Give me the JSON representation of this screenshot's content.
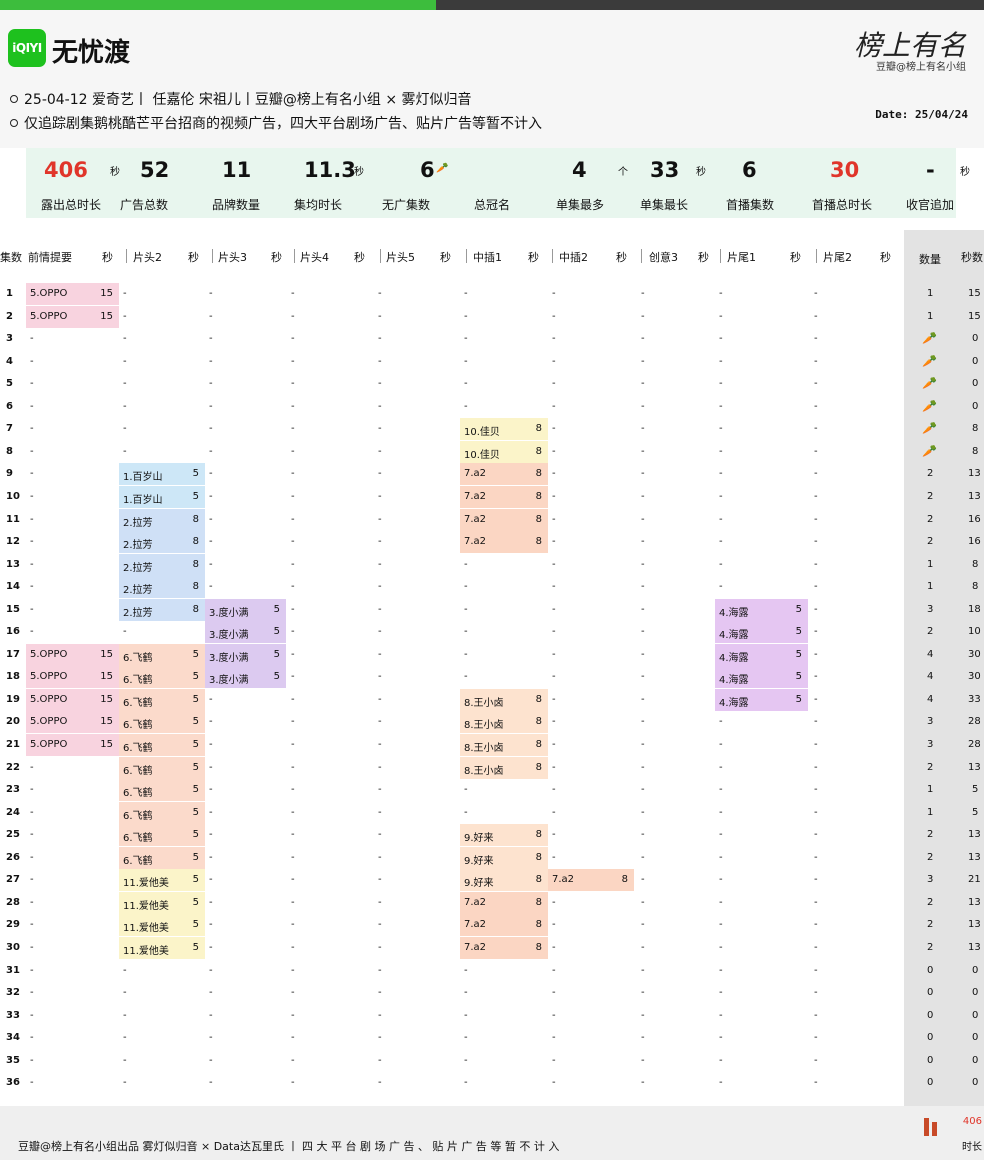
{
  "app": {
    "logo_text": "iQIYI",
    "show_title": "无忧渡",
    "info_line1": "25-04-12 爱奇艺丨 任嘉伦 宋祖儿丨豆瓣@榜上有名小组 × 雾灯似归音",
    "info_line2": "仅追踪剧集鹅桃酷芒平台招商的视频广告，四大平台剧场广告、贴片广告等暂不计入",
    "brand_signature": "榜上有名",
    "brand_sub": "豆瓣@榜上有名小组",
    "date": "Date: 25/04/24"
  },
  "stats": [
    {
      "value": "406",
      "unit": "秒",
      "label": "露出总时长",
      "red": true
    },
    {
      "value": "52",
      "unit": "",
      "label": "广告总数",
      "red": false
    },
    {
      "value": "11",
      "unit": "",
      "label": "品牌数量",
      "red": false
    },
    {
      "value": "11.3",
      "unit": "秒",
      "label": "集均时长",
      "red": false
    },
    {
      "value": "6",
      "unit": "🥕",
      "label": "无广集数",
      "red": false
    },
    {
      "value": "",
      "unit": "",
      "label": "总冠名",
      "red": false
    },
    {
      "value": "4",
      "unit": "个",
      "label": "单集最多",
      "red": false
    },
    {
      "value": "33",
      "unit": "秒",
      "label": "单集最长",
      "red": false
    },
    {
      "value": "6",
      "unit": "",
      "label": "首播集数",
      "red": false
    },
    {
      "value": "30",
      "unit": "",
      "label": "首播总时长",
      "red": true
    },
    {
      "value": "-",
      "unit": "秒",
      "label": "收官追加",
      "red": false
    }
  ],
  "columns": {
    "ep": "集数",
    "c1": "前情提要",
    "c1u": "秒",
    "c2": "片头2",
    "c2u": "秒",
    "c3": "片头3",
    "c3u": "秒",
    "c4": "片头4",
    "c4u": "秒",
    "c5": "片头5",
    "c5u": "秒",
    "c6": "中插1",
    "c6u": "秒",
    "c7": "中插2",
    "c7u": "秒",
    "c8": "创意3",
    "c8u": "秒",
    "c9": "片尾1",
    "c9u": "秒",
    "c10": "片尾2",
    "c10u": "秒",
    "count": "数量",
    "seconds": "秒数"
  },
  "rows": [
    {
      "ep": "1",
      "cells": [
        [
          "5.OPPO",
          "15"
        ],
        "-",
        "-",
        "-",
        "-",
        "-",
        "-",
        "-",
        "-",
        "-"
      ],
      "count": "1",
      "sec": "15"
    },
    {
      "ep": "2",
      "cells": [
        [
          "5.OPPO",
          "15"
        ],
        "-",
        "-",
        "-",
        "-",
        "-",
        "-",
        "-",
        "-",
        "-"
      ],
      "count": "1",
      "sec": "15"
    },
    {
      "ep": "3",
      "cells": [
        "-",
        "-",
        "-",
        "-",
        "-",
        "-",
        "-",
        "-",
        "-",
        "-"
      ],
      "count": "🥕",
      "sec": "0"
    },
    {
      "ep": "4",
      "cells": [
        "-",
        "-",
        "-",
        "-",
        "-",
        "-",
        "-",
        "-",
        "-",
        "-"
      ],
      "count": "🥕",
      "sec": "0"
    },
    {
      "ep": "5",
      "cells": [
        "-",
        "-",
        "-",
        "-",
        "-",
        "-",
        "-",
        "-",
        "-",
        "-"
      ],
      "count": "🥕",
      "sec": "0"
    },
    {
      "ep": "6",
      "cells": [
        "-",
        "-",
        "-",
        "-",
        "-",
        "-",
        "-",
        "-",
        "-",
        "-"
      ],
      "count": "🥕",
      "sec": "0"
    },
    {
      "ep": "7",
      "cells": [
        "-",
        "-",
        "-",
        "-",
        "-",
        [
          "10.佳贝",
          "8"
        ],
        "-",
        "-",
        "-",
        "-"
      ],
      "count": "🥕",
      "sec": "8"
    },
    {
      "ep": "8",
      "cells": [
        "-",
        "-",
        "-",
        "-",
        "-",
        [
          "10.佳贝",
          "8"
        ],
        "-",
        "-",
        "-",
        "-"
      ],
      "count": "🥕",
      "sec": "8"
    },
    {
      "ep": "9",
      "cells": [
        "-",
        [
          "1.百岁山",
          "5"
        ],
        "-",
        "-",
        "-",
        [
          "7.a2",
          "8"
        ],
        "-",
        "-",
        "-",
        "-"
      ],
      "count": "2",
      "sec": "13"
    },
    {
      "ep": "10",
      "cells": [
        "-",
        [
          "1.百岁山",
          "5"
        ],
        "-",
        "-",
        "-",
        [
          "7.a2",
          "8"
        ],
        "-",
        "-",
        "-",
        "-"
      ],
      "count": "2",
      "sec": "13"
    },
    {
      "ep": "11",
      "cells": [
        "-",
        [
          "2.拉芳",
          "8"
        ],
        "-",
        "-",
        "-",
        [
          "7.a2",
          "8"
        ],
        "-",
        "-",
        "-",
        "-"
      ],
      "count": "2",
      "sec": "16"
    },
    {
      "ep": "12",
      "cells": [
        "-",
        [
          "2.拉芳",
          "8"
        ],
        "-",
        "-",
        "-",
        [
          "7.a2",
          "8"
        ],
        "-",
        "-",
        "-",
        "-"
      ],
      "count": "2",
      "sec": "16"
    },
    {
      "ep": "13",
      "cells": [
        "-",
        [
          "2.拉芳",
          "8"
        ],
        "-",
        "-",
        "-",
        "-",
        "-",
        "-",
        "-",
        "-"
      ],
      "count": "1",
      "sec": "8"
    },
    {
      "ep": "14",
      "cells": [
        "-",
        [
          "2.拉芳",
          "8"
        ],
        "-",
        "-",
        "-",
        "-",
        "-",
        "-",
        "-",
        "-"
      ],
      "count": "1",
      "sec": "8"
    },
    {
      "ep": "15",
      "cells": [
        "-",
        [
          "2.拉芳",
          "8"
        ],
        [
          "3.度小满",
          "5"
        ],
        "-",
        "-",
        "-",
        "-",
        "-",
        [
          "4.海露",
          "5"
        ],
        "-"
      ],
      "count": "3",
      "sec": "18"
    },
    {
      "ep": "16",
      "cells": [
        "-",
        "-",
        [
          "3.度小满",
          "5"
        ],
        "-",
        "-",
        "-",
        "-",
        "-",
        [
          "4.海露",
          "5"
        ],
        "-"
      ],
      "count": "2",
      "sec": "10"
    },
    {
      "ep": "17",
      "cells": [
        [
          "5.OPPO",
          "15"
        ],
        [
          "6.飞鹤",
          "5"
        ],
        [
          "3.度小满",
          "5"
        ],
        "-",
        "-",
        "-",
        "-",
        "-",
        [
          "4.海露",
          "5"
        ],
        "-"
      ],
      "count": "4",
      "sec": "30"
    },
    {
      "ep": "18",
      "cells": [
        [
          "5.OPPO",
          "15"
        ],
        [
          "6.飞鹤",
          "5"
        ],
        [
          "3.度小满",
          "5"
        ],
        "-",
        "-",
        "-",
        "-",
        "-",
        [
          "4.海露",
          "5"
        ],
        "-"
      ],
      "count": "4",
      "sec": "30"
    },
    {
      "ep": "19",
      "cells": [
        [
          "5.OPPO",
          "15"
        ],
        [
          "6.飞鹤",
          "5"
        ],
        "-",
        "-",
        "-",
        [
          "8.王小卤",
          "8"
        ],
        "-",
        "-",
        [
          "4.海露",
          "5"
        ],
        "-"
      ],
      "count": "4",
      "sec": "33"
    },
    {
      "ep": "20",
      "cells": [
        [
          "5.OPPO",
          "15"
        ],
        [
          "6.飞鹤",
          "5"
        ],
        "-",
        "-",
        "-",
        [
          "8.王小卤",
          "8"
        ],
        "-",
        "-",
        "-",
        "-"
      ],
      "count": "3",
      "sec": "28"
    },
    {
      "ep": "21",
      "cells": [
        [
          "5.OPPO",
          "15"
        ],
        [
          "6.飞鹤",
          "5"
        ],
        "-",
        "-",
        "-",
        [
          "8.王小卤",
          "8"
        ],
        "-",
        "-",
        "-",
        "-"
      ],
      "count": "3",
      "sec": "28"
    },
    {
      "ep": "22",
      "cells": [
        "-",
        [
          "6.飞鹤",
          "5"
        ],
        "-",
        "-",
        "-",
        [
          "8.王小卤",
          "8"
        ],
        "-",
        "-",
        "-",
        "-"
      ],
      "count": "2",
      "sec": "13"
    },
    {
      "ep": "23",
      "cells": [
        "-",
        [
          "6.飞鹤",
          "5"
        ],
        "-",
        "-",
        "-",
        "-",
        "-",
        "-",
        "-",
        "-"
      ],
      "count": "1",
      "sec": "5"
    },
    {
      "ep": "24",
      "cells": [
        "-",
        [
          "6.飞鹤",
          "5"
        ],
        "-",
        "-",
        "-",
        "-",
        "-",
        "-",
        "-",
        "-"
      ],
      "count": "1",
      "sec": "5"
    },
    {
      "ep": "25",
      "cells": [
        "-",
        [
          "6.飞鹤",
          "5"
        ],
        "-",
        "-",
        "-",
        [
          "9.好来",
          "8"
        ],
        "-",
        "-",
        "-",
        "-"
      ],
      "count": "2",
      "sec": "13"
    },
    {
      "ep": "26",
      "cells": [
        "-",
        [
          "6.飞鹤",
          "5"
        ],
        "-",
        "-",
        "-",
        [
          "9.好来",
          "8"
        ],
        "-",
        "-",
        "-",
        "-"
      ],
      "count": "2",
      "sec": "13"
    },
    {
      "ep": "27",
      "cells": [
        "-",
        [
          "11.爱他美",
          "5"
        ],
        "-",
        "-",
        "-",
        [
          "9.好来",
          "8"
        ],
        [
          "7.a2",
          "8"
        ],
        "-",
        "-",
        "-"
      ],
      "count": "3",
      "sec": "21"
    },
    {
      "ep": "28",
      "cells": [
        "-",
        [
          "11.爱他美",
          "5"
        ],
        "-",
        "-",
        "-",
        [
          "7.a2",
          "8"
        ],
        "-",
        "-",
        "-",
        "-"
      ],
      "count": "2",
      "sec": "13"
    },
    {
      "ep": "29",
      "cells": [
        "-",
        [
          "11.爱他美",
          "5"
        ],
        "-",
        "-",
        "-",
        [
          "7.a2",
          "8"
        ],
        "-",
        "-",
        "-",
        "-"
      ],
      "count": "2",
      "sec": "13"
    },
    {
      "ep": "30",
      "cells": [
        "-",
        [
          "11.爱他美",
          "5"
        ],
        "-",
        "-",
        "-",
        [
          "7.a2",
          "8"
        ],
        "-",
        "-",
        "-",
        "-"
      ],
      "count": "2",
      "sec": "13"
    },
    {
      "ep": "31",
      "cells": [
        "-",
        "-",
        "-",
        "-",
        "-",
        "-",
        "-",
        "-",
        "-",
        "-"
      ],
      "count": "0",
      "sec": "0"
    },
    {
      "ep": "32",
      "cells": [
        "-",
        "-",
        "-",
        "-",
        "-",
        "-",
        "-",
        "-",
        "-",
        "-"
      ],
      "count": "0",
      "sec": "0"
    },
    {
      "ep": "33",
      "cells": [
        "-",
        "-",
        "-",
        "-",
        "-",
        "-",
        "-",
        "-",
        "-",
        "-"
      ],
      "count": "0",
      "sec": "0"
    },
    {
      "ep": "34",
      "cells": [
        "-",
        "-",
        "-",
        "-",
        "-",
        "-",
        "-",
        "-",
        "-",
        "-"
      ],
      "count": "0",
      "sec": "0"
    },
    {
      "ep": "35",
      "cells": [
        "-",
        "-",
        "-",
        "-",
        "-",
        "-",
        "-",
        "-",
        "-",
        "-"
      ],
      "count": "0",
      "sec": "0"
    },
    {
      "ep": "36",
      "cells": [
        "-",
        "-",
        "-",
        "-",
        "-",
        "-",
        "-",
        "-",
        "-",
        "-"
      ],
      "count": "0",
      "sec": "0"
    }
  ],
  "brand_colors": {
    "5.OPPO": "#f8d3df",
    "1.百岁山": "#cde7f7",
    "2.拉芳": "#cfe0f6",
    "3.度小满": "#dccaf0",
    "6.飞鹤": "#fbdacb",
    "11.爱他美": "#fbf4c9",
    "10.佳贝": "#fbf4c9",
    "7.a2": "#fbd6c3",
    "8.王小卤": "#fde3cf",
    "9.好来": "#fde3cf",
    "4.海露": "#e5c6f2"
  },
  "footer": {
    "text": "豆瓣@榜上有名小组出品  雾灯似归音 × Data达瓦里氏 丨 四 大 平 台 剧 场 广 告 、 贴 片 广 告 等 暂 不 计 入",
    "total": "406",
    "unit": "时长"
  }
}
